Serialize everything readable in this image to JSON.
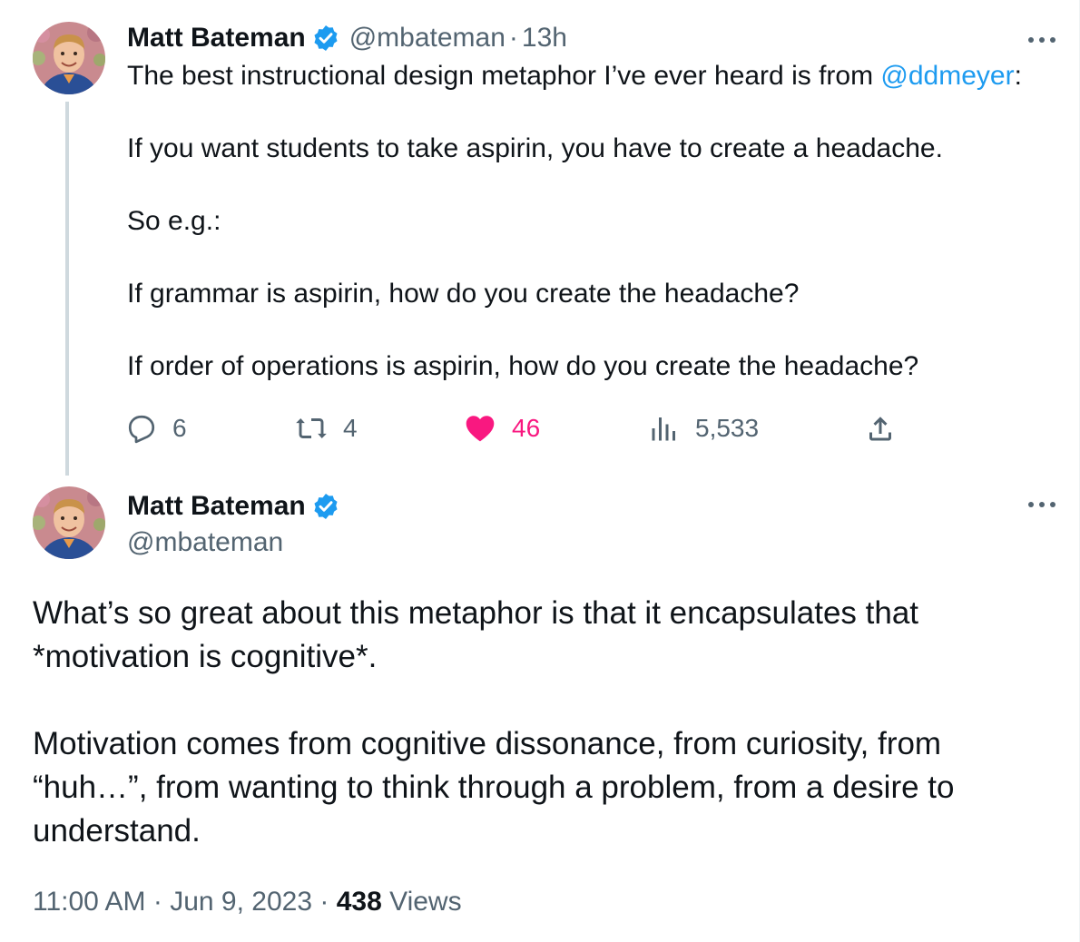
{
  "colors": {
    "text": "#0f1419",
    "secondary": "#536471",
    "link": "#1d9bf0",
    "like": "#f91880",
    "thread_line": "#cfd9de",
    "verified": "#1d9bf0"
  },
  "tweet1": {
    "author": {
      "name": "Matt Bateman",
      "handle": "@mbateman",
      "verified_icon": "verified-badge-icon",
      "avatar": "avatar"
    },
    "separator": "·",
    "time": "13h",
    "body": {
      "line1_prefix": "The best instructional design metaphor I’ve ever heard is from ",
      "mention": "@ddmeyer",
      "line1_suffix": ":",
      "paragraphs": [
        "If you want students to take aspirin, you have to create a headache.",
        "So e.g.:",
        "If grammar is aspirin, how do you create the headache?",
        "If order of operations is aspirin, how do you create the headache?"
      ]
    },
    "actions": {
      "replies": {
        "icon": "reply-icon",
        "count": "6"
      },
      "retweets": {
        "icon": "retweet-icon",
        "count": "4"
      },
      "likes": {
        "icon": "heart-icon",
        "count": "46",
        "liked": true
      },
      "views": {
        "icon": "views-icon",
        "count": "5,533"
      },
      "share": {
        "icon": "share-icon"
      }
    },
    "more_icon": "more-icon"
  },
  "tweet2": {
    "author": {
      "name": "Matt Bateman",
      "handle": "@mbateman",
      "verified_icon": "verified-badge-icon",
      "avatar": "avatar"
    },
    "body": {
      "paragraph1_line1": "What’s so great about this metaphor is that it encapsulates that",
      "paragraph1_line2": "*motivation is cognitive*.",
      "paragraph2_line1": "Motivation comes from cognitive dissonance, from curiosity, from",
      "paragraph2_line2": "“huh…”, from wanting to think through a problem, from a desire to",
      "paragraph2_line3": "understand."
    },
    "meta": {
      "time": "11:00 AM",
      "separator": "·",
      "date": "Jun 9, 2023",
      "views_count": "438",
      "views_label": "Views"
    },
    "more_icon": "more-icon"
  }
}
